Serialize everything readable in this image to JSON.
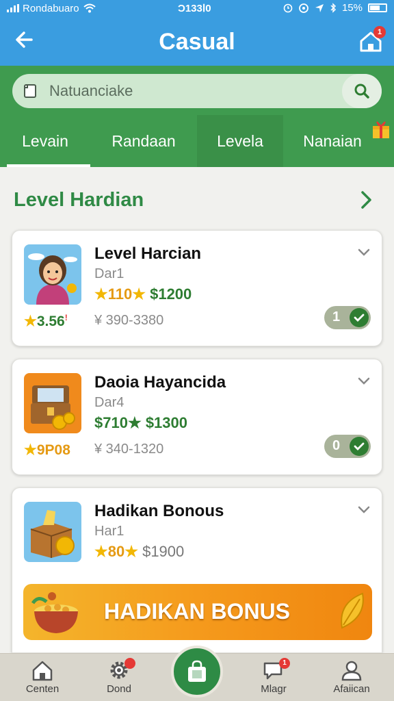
{
  "status_bar": {
    "carrier": "Rondabuaro",
    "time": "Ɔ133ꓲ0",
    "battery": "15%"
  },
  "app_bar": {
    "title": "Casual",
    "home_badge": "1"
  },
  "search": {
    "placeholder": "Natuanciake"
  },
  "tabs": [
    {
      "label": "Levain",
      "active": true
    },
    {
      "label": "Randaan",
      "active": false
    },
    {
      "label": "Levela",
      "active": false
    },
    {
      "label": "Nanaian",
      "active": false
    }
  ],
  "section": {
    "title": "Level Hardian"
  },
  "cards": [
    {
      "name": "Level Harcian",
      "day": "Dar1",
      "points": "110",
      "money": "$1200",
      "rating": "3.56",
      "range": "¥ 390-3380",
      "toggle": "1"
    },
    {
      "name": "Daoia Hayancida",
      "day": "Dar4",
      "points": "$710",
      "money": "$1300",
      "rating": "9P08",
      "range": "¥ 340-1320",
      "toggle": "0"
    },
    {
      "name": "Hadikan Bonous",
      "day": "Har1",
      "points": "80",
      "money": "$1900"
    }
  ],
  "bonus_banner": {
    "label": "HADIKAN BONUS"
  },
  "bottom_nav": [
    {
      "label": "Centen"
    },
    {
      "label": "Dond",
      "badge": ""
    },
    {
      "label": "Mlagr",
      "badge": "1"
    },
    {
      "label": "Afaiican"
    }
  ],
  "colors": {
    "primary_blue": "#3a9de0",
    "primary_green": "#3f9b4f",
    "accent_orange": "#f59a1c",
    "money_green": "#2e7d32"
  }
}
